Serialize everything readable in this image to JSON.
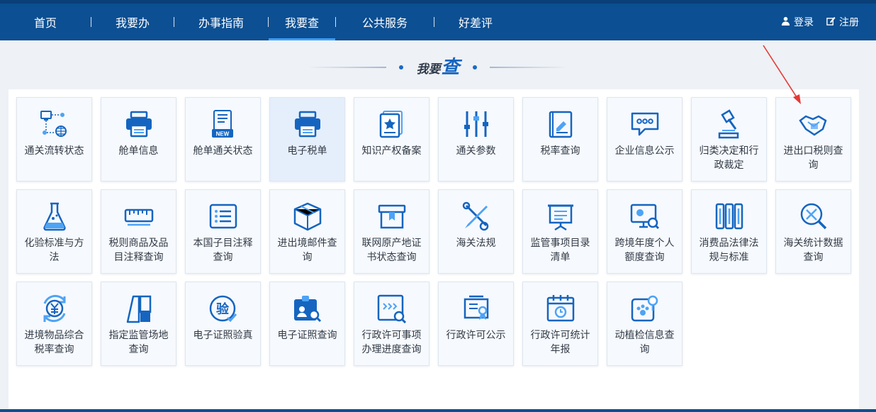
{
  "nav": {
    "items": [
      {
        "label": "首页",
        "name": "nav-home",
        "width": 128
      },
      {
        "label": "我要办",
        "name": "nav-handle",
        "width": 116
      },
      {
        "label": "办事指南",
        "name": "nav-guide",
        "width": 132
      },
      {
        "label": "我要查",
        "name": "nav-query",
        "width": 94,
        "active": true
      },
      {
        "label": "公共服务",
        "name": "nav-public-service",
        "width": 138
      },
      {
        "label": "好差评",
        "name": "nav-rating",
        "width": 116
      }
    ],
    "login_label": "登录",
    "register_label": "注册"
  },
  "section": {
    "title_prefix": "我要",
    "title_accent": "查"
  },
  "colors": {
    "nav_bg": "#0c4f92",
    "icon_blue": "#1565c0",
    "icon_light": "#4da3f5",
    "arrow_red": "#e53935"
  },
  "tiles": [
    {
      "label": "通关流转状态",
      "icon": "network-globe-icon"
    },
    {
      "label": "舱单信息",
      "icon": "printer-icon"
    },
    {
      "label": "舱单通关状态",
      "icon": "document-new-icon"
    },
    {
      "label": "电子税单",
      "icon": "printer-icon",
      "highlight": true
    },
    {
      "label": "知识产权备案",
      "icon": "certificate-star-icon"
    },
    {
      "label": "通关参数",
      "icon": "sliders-icon"
    },
    {
      "label": "税率查询",
      "icon": "book-icon"
    },
    {
      "label": "企业信息公示",
      "icon": "chat-bubble-icon"
    },
    {
      "label": "归类决定和行政裁定",
      "icon": "gavel-icon"
    },
    {
      "label": "进出口税则查询",
      "icon": "handshake-icon"
    },
    {
      "label": "化验标准与方法",
      "icon": "flask-icon"
    },
    {
      "label": "税则商品及品目注释查询",
      "icon": "ruler-icon"
    },
    {
      "label": "本国子目注释查询",
      "icon": "list-card-icon"
    },
    {
      "label": "进出境邮件查询",
      "icon": "package-icon"
    },
    {
      "label": "联网原产地证书状态查询",
      "icon": "box-bookmark-icon"
    },
    {
      "label": "海关法规",
      "icon": "tools-icon"
    },
    {
      "label": "监管事项目录清单",
      "icon": "easel-icon"
    },
    {
      "label": "跨境年度个人额度查询",
      "icon": "monitor-search-icon"
    },
    {
      "label": "消费品法律法规与标准",
      "icon": "books-icon"
    },
    {
      "label": "海关统计数据查询",
      "icon": "magnifier-tools-icon"
    },
    {
      "label": "进境物品综合税率查询",
      "icon": "yuan-cycle-icon"
    },
    {
      "label": "指定监管场地查询",
      "icon": "buildings-icon"
    },
    {
      "label": "电子证照验真",
      "icon": "verify-stamp-icon"
    },
    {
      "label": "电子证照查询",
      "icon": "id-search-icon"
    },
    {
      "label": "行政许可事项办理进度查询",
      "icon": "window-search-icon"
    },
    {
      "label": "行政许可公示",
      "icon": "certificate-icon"
    },
    {
      "label": "行政许可统计年报",
      "icon": "calendar-clock-icon"
    },
    {
      "label": "动植检信息查询",
      "icon": "plant-paw-icon"
    }
  ]
}
